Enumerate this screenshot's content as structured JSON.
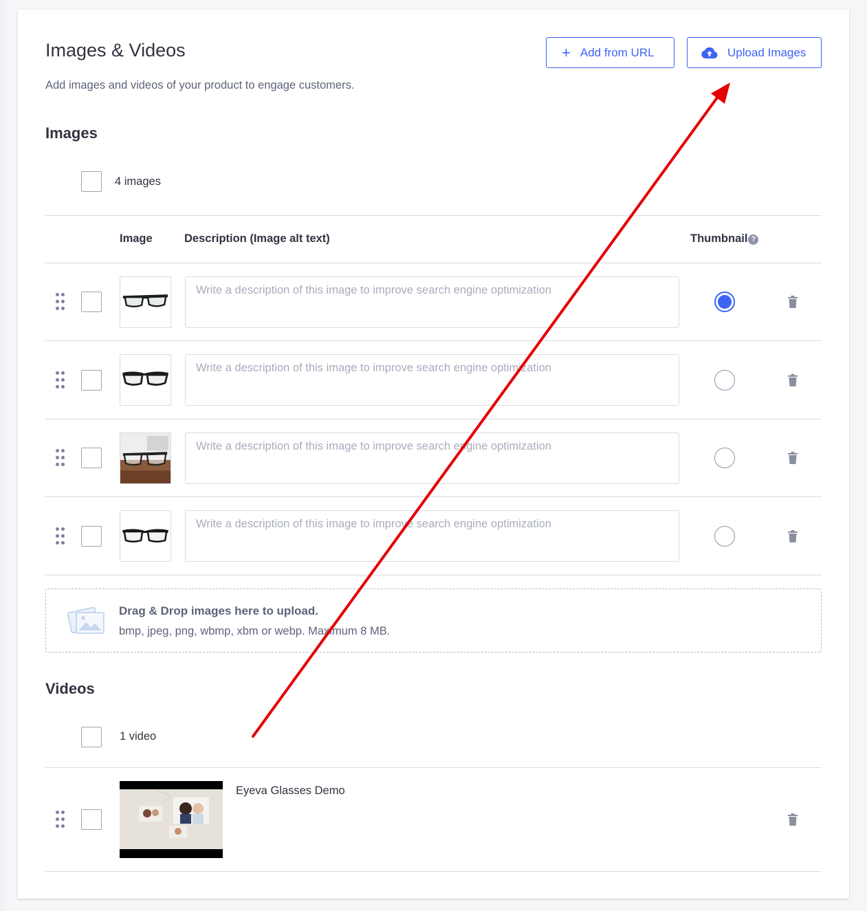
{
  "header": {
    "title": "Images & Videos",
    "subtitle": "Add images and videos of your product to engage customers.",
    "add_from_url_label": "Add from URL",
    "upload_images_label": "Upload Images"
  },
  "images": {
    "heading": "Images",
    "count_label": "4 images",
    "columns": {
      "image": "Image",
      "description": "Description (Image alt text)",
      "thumbnail": "Thumbnail"
    },
    "description_placeholder": "Write a description of this image to improve search engine optimization",
    "rows": [
      {
        "thumbnail_selected": true
      },
      {
        "thumbnail_selected": false
      },
      {
        "thumbnail_selected": false
      },
      {
        "thumbnail_selected": false
      }
    ],
    "dropzone": {
      "title": "Drag & Drop images here to upload.",
      "subtitle": "bmp, jpeg, png, wbmp, xbm or webp. Maximum 8 MB."
    }
  },
  "videos": {
    "heading": "Videos",
    "count_label": "1 video",
    "items": [
      {
        "title": "Eyeva Glasses Demo"
      }
    ]
  },
  "colors": {
    "accent": "#3c64f4",
    "annotation_arrow": "#e30000"
  },
  "icons": [
    "plus-icon",
    "cloud-upload-icon",
    "help-icon",
    "drag-handle-icon",
    "trash-icon",
    "images-placeholder-icon"
  ]
}
